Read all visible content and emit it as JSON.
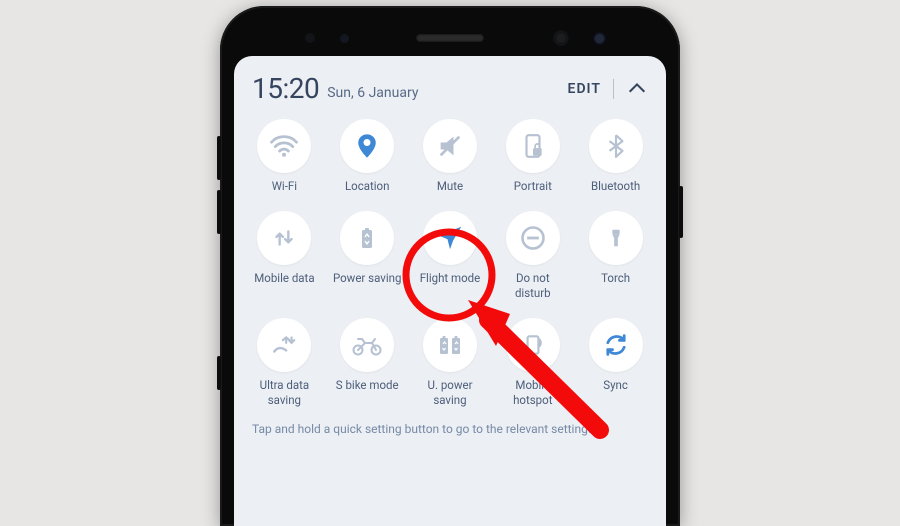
{
  "header": {
    "time": "15:20",
    "date": "Sun, 6 January",
    "edit_label": "EDIT"
  },
  "tiles": [
    {
      "label": "Wi-Fi"
    },
    {
      "label": "Location"
    },
    {
      "label": "Mute"
    },
    {
      "label": "Portrait"
    },
    {
      "label": "Bluetooth"
    },
    {
      "label": "Mobile data"
    },
    {
      "label": "Power saving"
    },
    {
      "label": "Flight mode"
    },
    {
      "label": "Do not disturb"
    },
    {
      "label": "Torch"
    },
    {
      "label": "Ultra data saving"
    },
    {
      "label": "S bike mode"
    },
    {
      "label": "U. power saving"
    },
    {
      "label": "Mobile hotspot"
    },
    {
      "label": "Sync"
    }
  ],
  "hint": "Tap and hold a quick setting button to go to the relevant settings.",
  "colors": {
    "panel_bg": "#eceff3",
    "text": "#3b4a63",
    "icon_muted": "#b6c1d2",
    "icon_active": "#3f88d6",
    "annotation": "#f30b0b"
  }
}
